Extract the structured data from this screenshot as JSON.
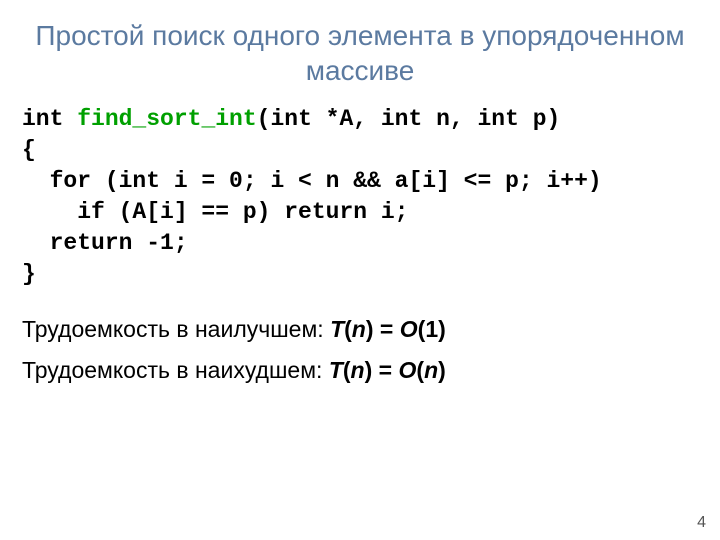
{
  "title": "Простой поиск одного элемента в упорядоченном массиве",
  "code": {
    "l1a": "int ",
    "l1fn": "find_sort_int",
    "l1b": "(int *A, int n, int p)",
    "l2": "{",
    "l3": "  for (int i = 0; i < n && a[i] <= p; i++)",
    "l4": "    if (A[i] == p) return i;",
    "l5": "  return -1;",
    "l6": "}"
  },
  "complexity": {
    "best_label": "Трудоемкость в наилучшем: ",
    "worst_label": "Трудоемкость в наихудшем: ",
    "T": "T",
    "open": "(",
    "n": "n",
    "close": ")",
    "eq": " = ",
    "O": "O",
    "one": "1"
  },
  "page": "4"
}
